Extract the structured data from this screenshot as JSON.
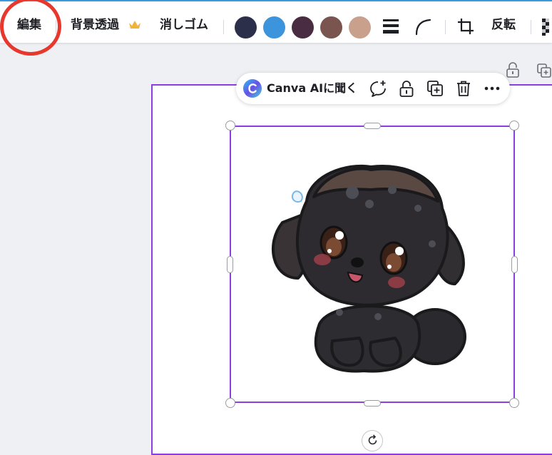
{
  "toolbar": {
    "edit_label": "編集",
    "bg_remove_label": "背景透過",
    "eraser_label": "消しゴム",
    "flip_label": "反転",
    "swatches": [
      {
        "name": "navy",
        "color": "#2c2f4a"
      },
      {
        "name": "blue",
        "color": "#3c95dc"
      },
      {
        "name": "plum",
        "color": "#4a2c42"
      },
      {
        "name": "brown",
        "color": "#7a554f"
      },
      {
        "name": "tan",
        "color": "#c8a08b"
      }
    ],
    "icons": [
      "line-weight-icon",
      "corner-rounding-icon",
      "crop-icon",
      "transparency-icon"
    ]
  },
  "floating_toolbar": {
    "ask_ai_label": "Canva AIに聞く",
    "icons": [
      "comment-add-icon",
      "lock-icon",
      "duplicate-icon",
      "trash-icon",
      "more-icon"
    ]
  },
  "canvas": {
    "selected_element": "black-poodle-puppy-illustration",
    "icons": [
      "page-lock-icon",
      "page-duplicate-icon",
      "rotate-icon"
    ]
  },
  "colors": {
    "selection": "#8b3fe0",
    "annotation_circle": "#e8372c",
    "premium_crown": "#f2b33d"
  }
}
